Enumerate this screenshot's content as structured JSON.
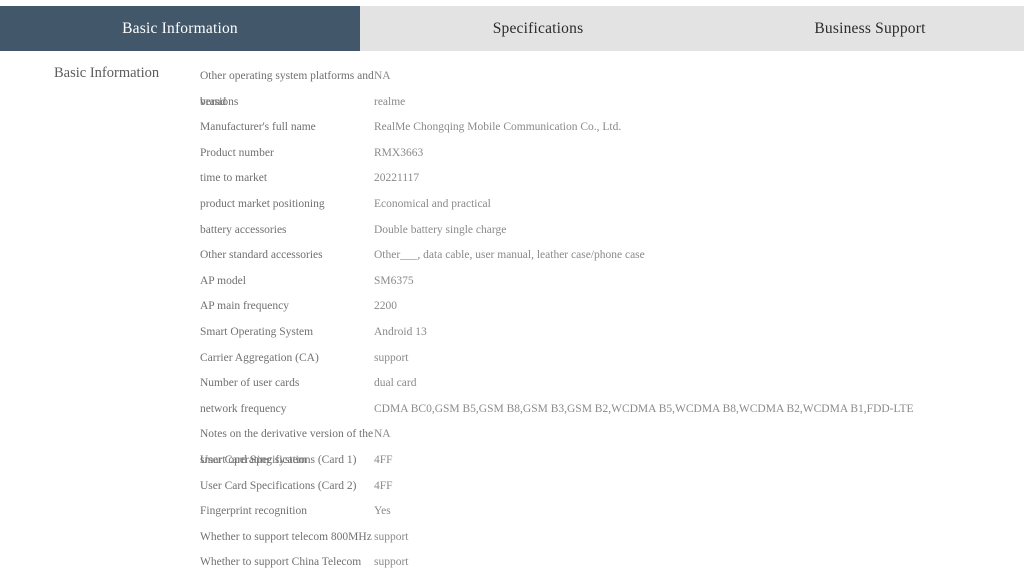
{
  "tabs": [
    {
      "id": "basic-information",
      "label": "Basic Information",
      "active": true
    },
    {
      "id": "specifications",
      "label": "Specifications",
      "active": false
    },
    {
      "id": "business-support",
      "label": "Business Support",
      "active": false
    }
  ],
  "section": {
    "title": "Basic Information"
  },
  "colors": {
    "active_tab_bg": "#42576a",
    "active_tab_text": "#ffffff",
    "tabbar_bg": "#e3e3e3",
    "tab_text": "#2b2b2b",
    "label_text": "#707070",
    "value_text": "#8a8a8a",
    "page_bg": "#ffffff"
  },
  "spec_rows": [
    {
      "label": "Other operating system platforms and",
      "label_overflow": "versions",
      "value": "NA"
    },
    {
      "label": "brand",
      "value": "realme"
    },
    {
      "label": "Manufacturer's full name",
      "value": "RealMe Chongqing Mobile Communication Co., Ltd."
    },
    {
      "label": "Product number",
      "value": "RMX3663"
    },
    {
      "label": "time to market",
      "value": "20221117"
    },
    {
      "label": "product market positioning",
      "value": "Economical and practical"
    },
    {
      "label": "battery accessories",
      "value": "Double battery single charge"
    },
    {
      "label": "Other standard accessories",
      "value": "Other___, data cable, user manual, leather case/phone case"
    },
    {
      "label": "AP model",
      "value": "SM6375"
    },
    {
      "label": "AP main frequency",
      "value": "2200"
    },
    {
      "label": "Smart Operating System",
      "value": "Android 13"
    },
    {
      "label": "Carrier Aggregation (CA)",
      "value": "support"
    },
    {
      "label": "Number of user cards",
      "value": "dual card"
    },
    {
      "label": "network frequency",
      "value": "CDMA BC0,GSM B5,GSM B8,GSM B3,GSM B2,WCDMA B5,WCDMA B8,WCDMA B2,WCDMA B1,FDD-LTE"
    },
    {
      "label": "Notes on the derivative version of the",
      "label_overflow": "smart operating system",
      "value": "NA"
    },
    {
      "label": "User Card Specifications (Card 1)",
      "value": "4FF"
    },
    {
      "label": "User Card Specifications (Card 2)",
      "value": "4FF"
    },
    {
      "label": "Fingerprint recognition",
      "value": "Yes"
    },
    {
      "label": "Whether to support telecom 800MHz",
      "value": "support"
    },
    {
      "label": "Whether to support China Telecom",
      "value": "support"
    }
  ]
}
